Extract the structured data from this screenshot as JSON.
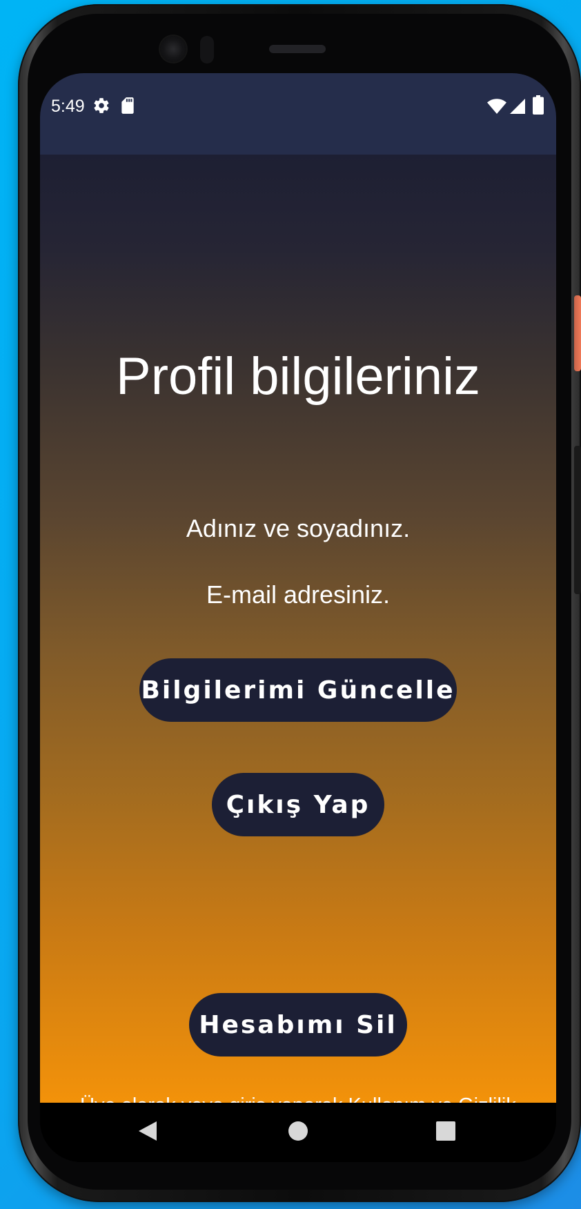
{
  "device": {
    "name": "Android phone emulator"
  },
  "status_bar": {
    "time": "5:49",
    "icons": [
      "settings-icon",
      "sd-card-icon",
      "wifi-icon",
      "cell-signal-icon",
      "battery-icon"
    ],
    "background_color": "#252d4b"
  },
  "profile": {
    "title": "Profil bilgileriniz",
    "name_text": "Adınız ve soyadınız.",
    "email_text": "E-mail adresiniz."
  },
  "buttons": {
    "update_label": "Bilgilerimi Güncelle",
    "logout_label": "Çıkış Yap",
    "delete_label": "Hesabımı Sil"
  },
  "footer": {
    "terms_text": "Üye olarak veya giriş yaparak Kullanım ve Gizlilik Koşullarını kabul etmiş sayılırsınız."
  },
  "nav_bar": {
    "items": [
      "back-icon",
      "home-icon",
      "recents-icon"
    ]
  },
  "colors": {
    "button_bg": "#1c1f35",
    "gradient_top": "#1d1f33",
    "gradient_bottom": "#f3920a",
    "desktop_bg": "#00b4f5"
  }
}
